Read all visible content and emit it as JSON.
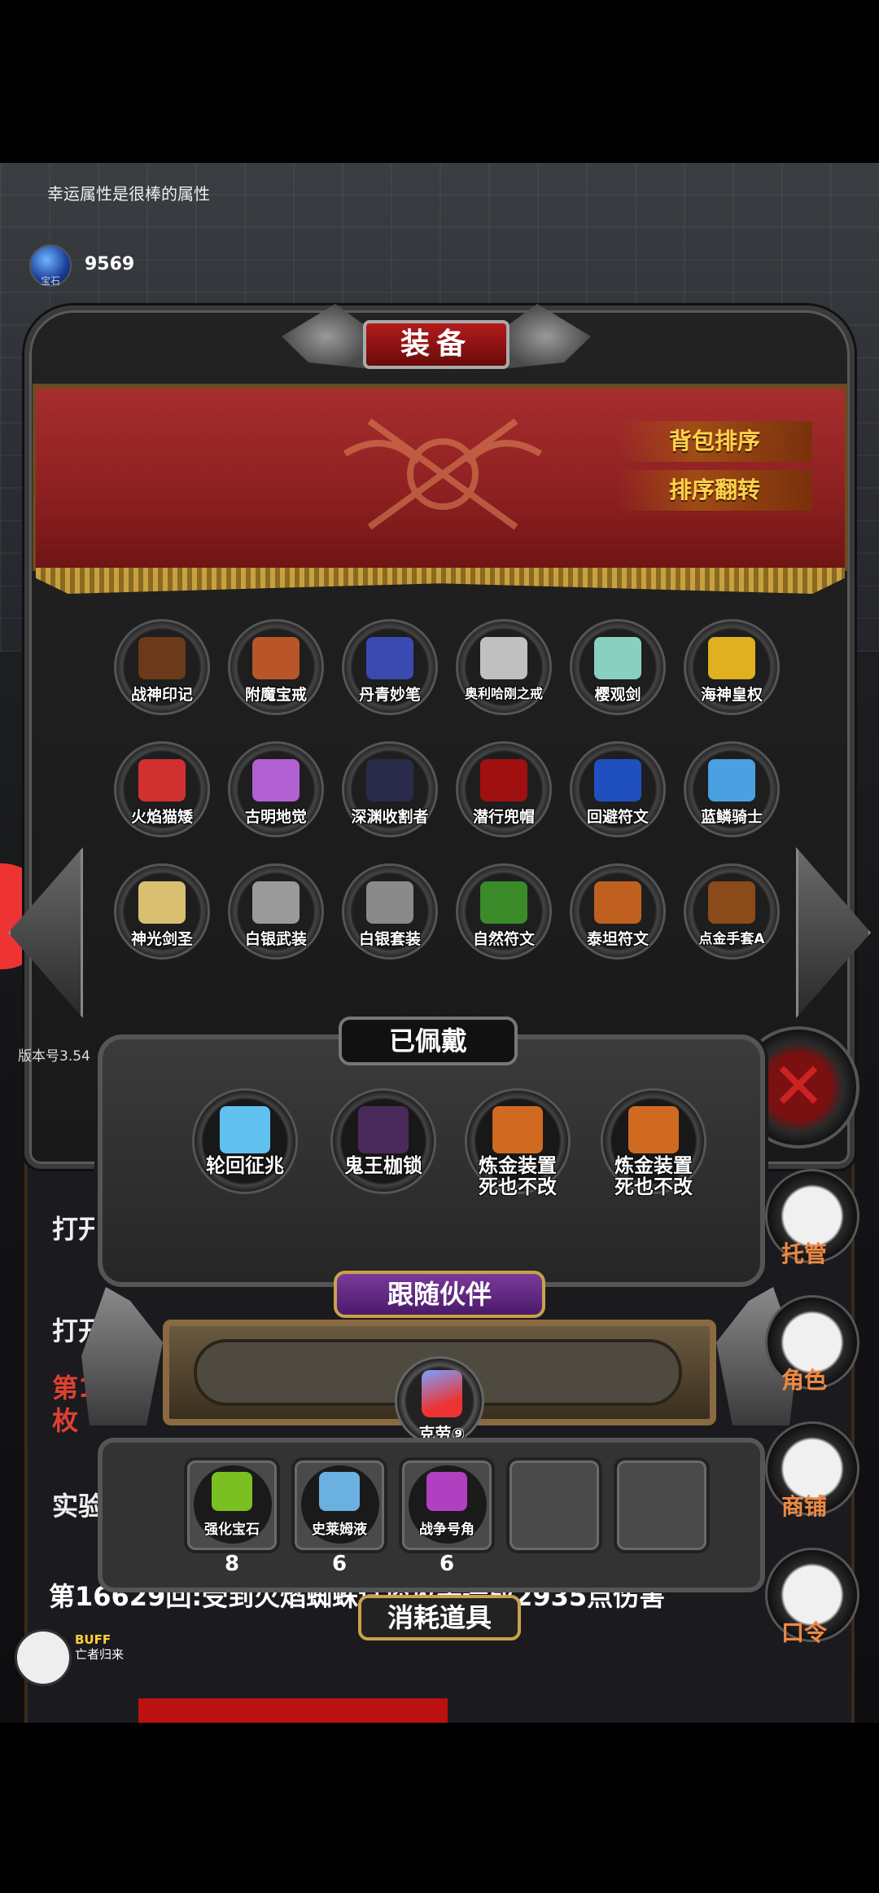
{
  "top_tip": "幸运属性是很棒的属性",
  "currency": {
    "amount": "9569",
    "label": "宝石"
  },
  "panel_title": "装备",
  "sort_buttons": [
    "背包排序",
    "排序翻转"
  ],
  "inventory": [
    {
      "name": "战神印记",
      "color": "#6a3a1a"
    },
    {
      "name": "附魔宝戒",
      "color": "#b8562a"
    },
    {
      "name": "丹青妙笔",
      "color": "#3a4ab0"
    },
    {
      "name": "奥利哈刚之戒",
      "color": "#c0c0c0"
    },
    {
      "name": "樱观剑",
      "color": "#8ad0c0"
    },
    {
      "name": "海神皇权",
      "color": "#e0b020"
    },
    {
      "name": "火焰猫矮",
      "color": "#d03030"
    },
    {
      "name": "古明地觉",
      "color": "#b060d0"
    },
    {
      "name": "深渊收割者",
      "color": "#2a2a4a"
    },
    {
      "name": "潜行兜帽",
      "color": "#a01010"
    },
    {
      "name": "回避符文",
      "color": "#2050c0"
    },
    {
      "name": "蓝鳞骑士",
      "color": "#4aa0e0"
    },
    {
      "name": "神光剑圣",
      "color": "#d8c070"
    },
    {
      "name": "白银武装",
      "color": "#9a9a9a"
    },
    {
      "name": "白银套装",
      "color": "#8a8a8a"
    },
    {
      "name": "自然符文",
      "color": "#3a8a2a"
    },
    {
      "name": "泰坦符文",
      "color": "#c06020"
    },
    {
      "name": "点金手套A",
      "color": "#8a4a1a"
    }
  ],
  "version": "版本号3.54",
  "equipped": {
    "title": "已佩戴",
    "items": [
      {
        "name": "轮回征兆",
        "color": "#60c0f0"
      },
      {
        "name": "鬼王枷锁",
        "color": "#4a2a5a"
      },
      {
        "name": "炼金装置\n死也不改",
        "color": "#d06a20"
      },
      {
        "name": "炼金装置\n死也不改",
        "color": "#d06a20"
      }
    ]
  },
  "companion": {
    "title": "跟随伙伴",
    "name": "克劳⑨"
  },
  "consumables": {
    "title": "消耗道具",
    "items": [
      {
        "name": "强化宝石",
        "count": "8",
        "color": "#7ac020"
      },
      {
        "name": "史莱姆液",
        "count": "6",
        "color": "#6ab0e0"
      },
      {
        "name": "战争号角",
        "count": "6",
        "color": "#b040c0"
      },
      {
        "name": "",
        "count": "",
        "color": ""
      },
      {
        "name": "",
        "count": "",
        "color": ""
      }
    ]
  },
  "side_menu": [
    "托管",
    "角色",
    "商铺",
    "口令"
  ],
  "log": {
    "line1": "打开",
    "line2": "打开",
    "line3a": "第16",
    "line3b": "枚",
    "line4": "实验",
    "long": "第16629回:受到火焰蜘蛛试探攻击造成2935点伤害"
  },
  "buff": {
    "label": "BUFF",
    "sub": "亡者归来"
  }
}
